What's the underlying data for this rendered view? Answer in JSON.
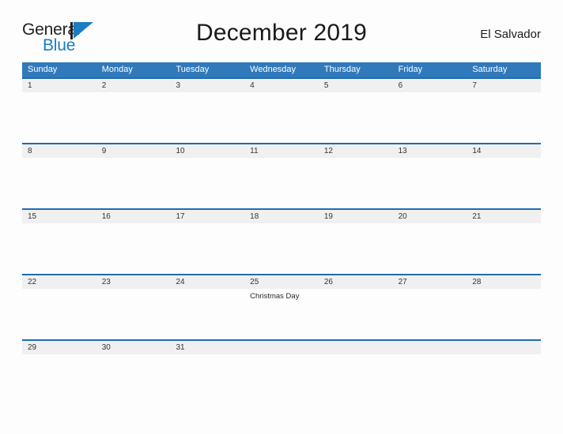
{
  "logo": {
    "word_one": "General",
    "word_two": "Blue",
    "mark": "triangle-logo-icon",
    "primary_color": "#1a7dc4",
    "dark_color": "#231f20"
  },
  "header": {
    "title": "December 2019",
    "region": "El Salvador"
  },
  "theme": {
    "header_blue": "#3079bb",
    "divider_blue": "#1f6cb0",
    "date_strip_gray": "#f0f0f0",
    "page_background": "#fdfdfd"
  },
  "calendar": {
    "month": "December",
    "year": "2019",
    "weekday_headers": [
      "Sunday",
      "Monday",
      "Tuesday",
      "Wednesday",
      "Thursday",
      "Friday",
      "Saturday"
    ],
    "weeks": [
      {
        "height": "tall",
        "days": [
          {
            "date": "1",
            "event": ""
          },
          {
            "date": "2",
            "event": ""
          },
          {
            "date": "3",
            "event": ""
          },
          {
            "date": "4",
            "event": ""
          },
          {
            "date": "5",
            "event": ""
          },
          {
            "date": "6",
            "event": ""
          },
          {
            "date": "7",
            "event": ""
          }
        ]
      },
      {
        "height": "tall",
        "days": [
          {
            "date": "8",
            "event": ""
          },
          {
            "date": "9",
            "event": ""
          },
          {
            "date": "10",
            "event": ""
          },
          {
            "date": "11",
            "event": ""
          },
          {
            "date": "12",
            "event": ""
          },
          {
            "date": "13",
            "event": ""
          },
          {
            "date": "14",
            "event": ""
          }
        ]
      },
      {
        "height": "tall",
        "days": [
          {
            "date": "15",
            "event": ""
          },
          {
            "date": "16",
            "event": ""
          },
          {
            "date": "17",
            "event": ""
          },
          {
            "date": "18",
            "event": ""
          },
          {
            "date": "19",
            "event": ""
          },
          {
            "date": "20",
            "event": ""
          },
          {
            "date": "21",
            "event": ""
          }
        ]
      },
      {
        "height": "tall",
        "days": [
          {
            "date": "22",
            "event": ""
          },
          {
            "date": "23",
            "event": ""
          },
          {
            "date": "24",
            "event": ""
          },
          {
            "date": "25",
            "event": "Christmas Day"
          },
          {
            "date": "26",
            "event": ""
          },
          {
            "date": "27",
            "event": ""
          },
          {
            "date": "28",
            "event": ""
          }
        ]
      },
      {
        "height": "short",
        "days": [
          {
            "date": "29",
            "event": ""
          },
          {
            "date": "30",
            "event": ""
          },
          {
            "date": "31",
            "event": ""
          },
          {
            "date": "",
            "event": ""
          },
          {
            "date": "",
            "event": ""
          },
          {
            "date": "",
            "event": ""
          },
          {
            "date": "",
            "event": ""
          }
        ]
      }
    ]
  }
}
